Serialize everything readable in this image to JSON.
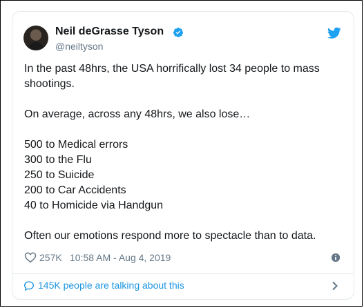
{
  "tweet": {
    "author_name": "Neil deGrasse Tyson",
    "author_handle": "@neiltyson",
    "lines": [
      "In the past 48hrs, the USA horrifically lost 34 people to mass shootings.",
      "",
      "On average, across any 48hrs, we also lose…",
      "",
      "500 to Medical errors",
      "300 to the Flu",
      "250 to Suicide",
      "200 to Car Accidents",
      "40 to Homicide via Handgun",
      "",
      "Often our emotions respond more to spectacle than to data."
    ],
    "like_count": "257K",
    "timestamp": "10:58 AM - Aug 4, 2019",
    "talking_label": "145K people are talking about this"
  },
  "icons": {
    "verified": "verified-badge-icon",
    "bird": "twitter-bird-icon",
    "heart": "heart-icon",
    "info": "info-icon",
    "bubble": "speech-bubble-icon",
    "chevron": "chevron-right-icon"
  },
  "colors": {
    "accent": "#1da1f2",
    "link": "#1b95e0",
    "muted": "#657786",
    "text": "#14171a",
    "border": "#e1e8ed"
  }
}
